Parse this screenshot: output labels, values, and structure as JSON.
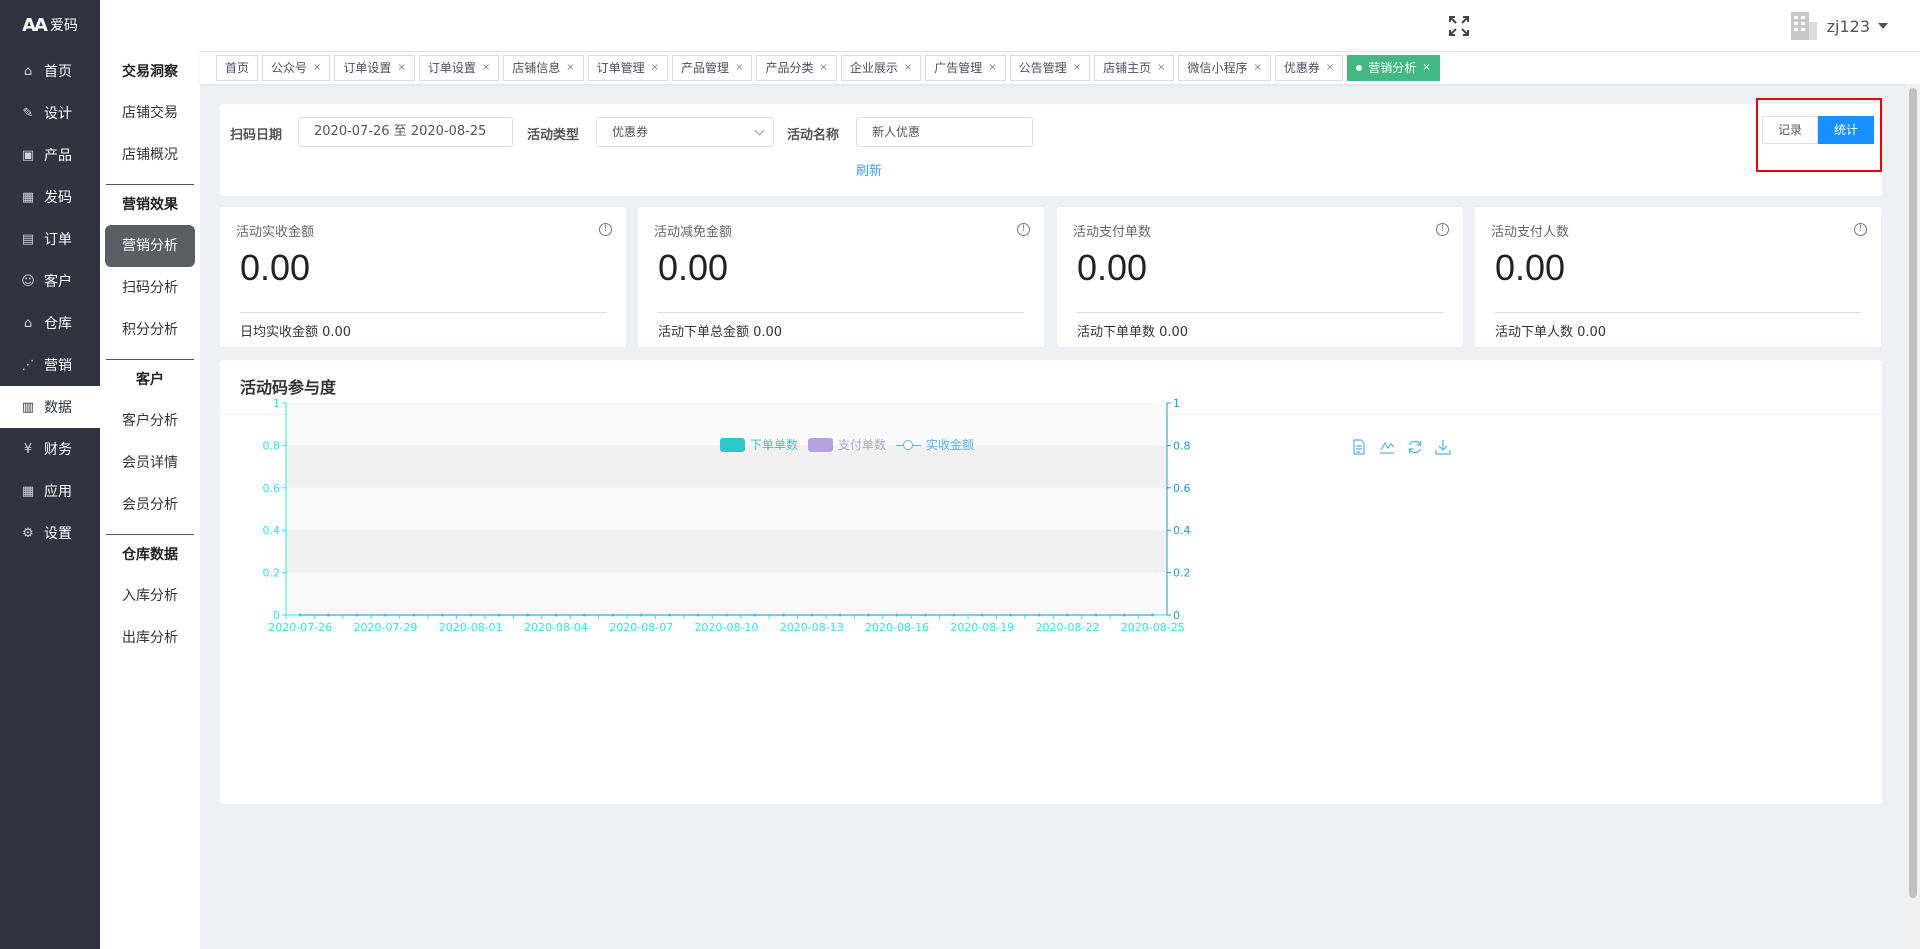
{
  "app": {
    "logo_text": "爱码",
    "logo_mark": "AA"
  },
  "sidebar": {
    "items": [
      {
        "label": "首页",
        "icon": "home-icon"
      },
      {
        "label": "设计",
        "icon": "design-icon"
      },
      {
        "label": "产品",
        "icon": "box-icon"
      },
      {
        "label": "发码",
        "icon": "qrcode-icon"
      },
      {
        "label": "订单",
        "icon": "order-icon"
      },
      {
        "label": "客户",
        "icon": "user-icon"
      },
      {
        "label": "仓库",
        "icon": "warehouse-icon"
      },
      {
        "label": "营销",
        "icon": "share-icon"
      },
      {
        "label": "数据",
        "icon": "bar-chart-icon",
        "active": true
      },
      {
        "label": "财务",
        "icon": "yen-icon"
      },
      {
        "label": "应用",
        "icon": "grid-icon"
      },
      {
        "label": "设置",
        "icon": "gear-icon"
      }
    ]
  },
  "submenu": {
    "group1": {
      "title": "交易洞察",
      "items": [
        "店铺交易",
        "店铺概况"
      ]
    },
    "group2": {
      "title": "营销效果",
      "items": [
        "营销分析",
        "扫码分析",
        "积分分析"
      ]
    },
    "group3": {
      "title": "客户",
      "items": [
        "客户分析",
        "会员详情",
        "会员分析"
      ]
    },
    "group4": {
      "title": "仓库数据",
      "items": [
        "入库分析",
        "出库分析"
      ]
    }
  },
  "header": {
    "username": "zj123"
  },
  "tabs": [
    {
      "label": "首页",
      "closable": false
    },
    {
      "label": "公众号",
      "closable": true
    },
    {
      "label": "订单设置",
      "closable": true
    },
    {
      "label": "订单设置",
      "closable": true
    },
    {
      "label": "店铺信息",
      "closable": true
    },
    {
      "label": "订单管理",
      "closable": true
    },
    {
      "label": "产品管理",
      "closable": true
    },
    {
      "label": "产品分类",
      "closable": true
    },
    {
      "label": "企业展示",
      "closable": true
    },
    {
      "label": "广告管理",
      "closable": true
    },
    {
      "label": "公告管理",
      "closable": true
    },
    {
      "label": "店铺主页",
      "closable": true
    },
    {
      "label": "微信小程序",
      "closable": true
    },
    {
      "label": "优惠券",
      "closable": true
    },
    {
      "label": "营销分析",
      "closable": true,
      "active": true
    }
  ],
  "filters": {
    "date_label": "扫码日期",
    "date_value": "2020-07-26 至 2020-08-25",
    "type_label": "活动类型",
    "type_value": "优惠券",
    "name_label": "活动名称",
    "name_value": "新人优惠",
    "refresh": "刷新",
    "toggle": {
      "record": "记录",
      "stats": "统计"
    }
  },
  "stats": [
    {
      "title": "活动实收金额",
      "value": "0.00",
      "foot": "日均实收金额 0.00"
    },
    {
      "title": "活动减免金额",
      "value": "0.00",
      "foot": "活动下单总金额 0.00"
    },
    {
      "title": "活动支付单数",
      "value": "0.00",
      "foot": "活动下单单数 0.00"
    },
    {
      "title": "活动支付人数",
      "value": "0.00",
      "foot": "活动下单人数 0.00"
    }
  ],
  "chart": {
    "title": "活动码参与度",
    "legend": [
      {
        "name": "下单单数",
        "color": "#2ec7c9"
      },
      {
        "name": "支付单数",
        "color": "#b6a2de"
      },
      {
        "name": "实收金额",
        "color": "#5ab1ef"
      }
    ],
    "tools": [
      "data-view-icon",
      "line-chart-icon",
      "refresh-icon",
      "download-icon"
    ]
  },
  "chart_data": {
    "type": "bar",
    "title": "",
    "x_tick_labels": [
      "2020-07-26",
      "2020-07-29",
      "2020-08-01",
      "2020-08-04",
      "2020-08-07",
      "2020-08-10",
      "2020-08-13",
      "2020-08-16",
      "2020-08-19",
      "2020-08-22",
      "2020-08-25"
    ],
    "x": [
      "2020-07-26",
      "2020-07-27",
      "2020-07-28",
      "2020-07-29",
      "2020-07-30",
      "2020-07-31",
      "2020-08-01",
      "2020-08-02",
      "2020-08-03",
      "2020-08-04",
      "2020-08-05",
      "2020-08-06",
      "2020-08-07",
      "2020-08-08",
      "2020-08-09",
      "2020-08-10",
      "2020-08-11",
      "2020-08-12",
      "2020-08-13",
      "2020-08-14",
      "2020-08-15",
      "2020-08-16",
      "2020-08-17",
      "2020-08-18",
      "2020-08-19",
      "2020-08-20",
      "2020-08-21",
      "2020-08-22",
      "2020-08-23",
      "2020-08-24",
      "2020-08-25"
    ],
    "series": [
      {
        "name": "下单单数",
        "type": "bar",
        "values": [
          0,
          0,
          0,
          0,
          0,
          0,
          0,
          0,
          0,
          0,
          0,
          0,
          0,
          0,
          0,
          0,
          0,
          0,
          0,
          0,
          0,
          0,
          0,
          0,
          0,
          0,
          0,
          0,
          0,
          0,
          0
        ]
      },
      {
        "name": "支付单数",
        "type": "bar",
        "values": [
          0,
          0,
          0,
          0,
          0,
          0,
          0,
          0,
          0,
          0,
          0,
          0,
          0,
          0,
          0,
          0,
          0,
          0,
          0,
          0,
          0,
          0,
          0,
          0,
          0,
          0,
          0,
          0,
          0,
          0,
          0
        ]
      },
      {
        "name": "实收金额",
        "type": "line",
        "values": [
          0,
          0,
          0,
          0,
          0,
          0,
          0,
          0,
          0,
          0,
          0,
          0,
          0,
          0,
          0,
          0,
          0,
          0,
          0,
          0,
          0,
          0,
          0,
          0,
          0,
          0,
          0,
          0,
          0,
          0,
          0
        ]
      }
    ],
    "ylim": [
      0,
      1
    ],
    "y_ticks": [
      "0",
      "0.2",
      "0.4",
      "0.6",
      "0.8",
      "1"
    ],
    "y2lim": [
      0,
      1
    ],
    "y2_ticks": [
      "0",
      "0.2",
      "0.4",
      "0.6",
      "0.8",
      "1"
    ],
    "grid": true,
    "legend_position": "top-center"
  }
}
